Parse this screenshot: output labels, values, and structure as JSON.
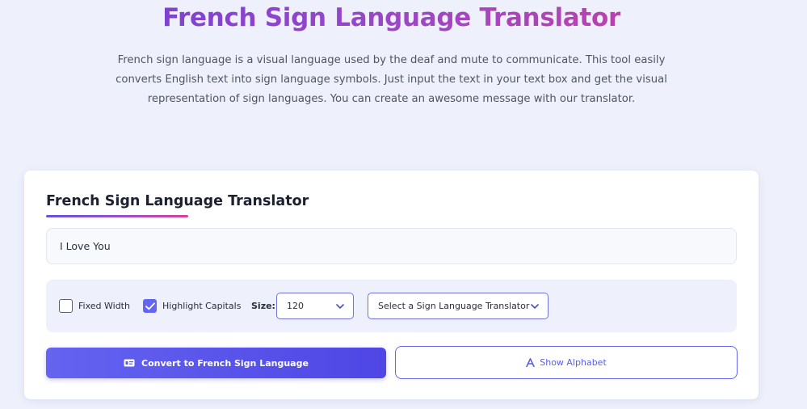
{
  "hero": {
    "title": "French Sign Language Translator",
    "description": "French sign language is a visual language used by the deaf and mute to communicate. This tool easily converts English text into sign language symbols. Just input the text in your text box and get the visual representation of sign languages. You can create an awesome message with our translator."
  },
  "card": {
    "title": "French Sign Language Translator",
    "input_value": "I Love You"
  },
  "options": {
    "fixed_width": {
      "label": "Fixed Width",
      "checked": false
    },
    "highlight_capitals": {
      "label": "Highlight Capitals",
      "checked": true
    },
    "size_label": "Size:",
    "size_value": "120",
    "translator_select": "Select a Sign Language Translator"
  },
  "buttons": {
    "convert": "Convert to French Sign Language",
    "alphabet": "Show Alphabet"
  },
  "colors": {
    "accent": "#6366f1",
    "background": "#eef0fb",
    "title_gradient_start": "#6a3fd8",
    "title_gradient_end": "#cc3f9a"
  },
  "icons": {
    "convert": "sign-card-icon",
    "alphabet": "letter-a-icon",
    "dropdown": "chevron-down-icon"
  }
}
